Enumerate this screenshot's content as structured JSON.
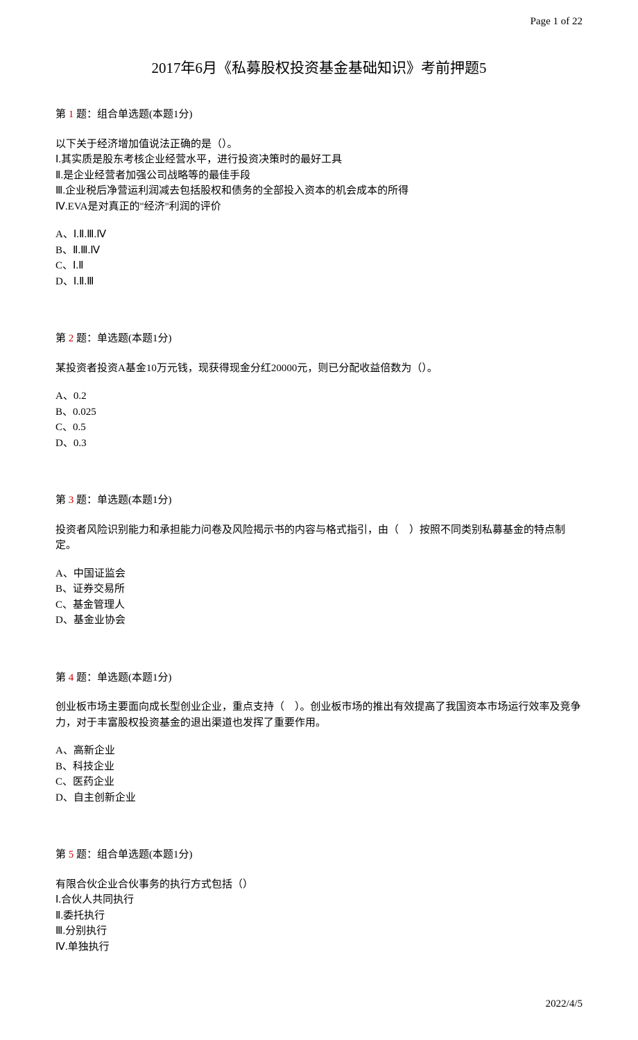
{
  "page_header": "Page 1 of 22",
  "title": "2017年6月《私募股权投资基金基础知识》考前押题5",
  "questions": [
    {
      "label_prefix": "第 ",
      "num": "1",
      "label_suffix": " 题：组合单选题(本题1分)",
      "lines": [
        "以下关于经济增加值说法正确的是（）。",
        "Ⅰ.其实质是股东考核企业经营水平，进行投资决策时的最好工具",
        "Ⅱ.是企业经营者加强公司战略等的最佳手段",
        "Ⅲ.企业税后净营运利润减去包括股权和债务的全部投入资本的机会成本的所得",
        "Ⅳ.EVA是对真正的\"经济\"利润的评价"
      ],
      "options": [
        "A、Ⅰ.Ⅱ.Ⅲ.Ⅳ",
        "B、Ⅱ.Ⅲ.Ⅳ",
        "C、Ⅰ.Ⅱ",
        "D、Ⅰ.Ⅱ.Ⅲ"
      ]
    },
    {
      "label_prefix": "第 ",
      "num": "2",
      "label_suffix": " 题：单选题(本题1分)",
      "lines": [
        "某投资者投资A基金10万元钱，现获得现金分红20000元，则已分配收益倍数为（）。"
      ],
      "options": [
        "A、0.2",
        "B、0.025",
        "C、0.5",
        "D、0.3"
      ]
    },
    {
      "label_prefix": "第 ",
      "num": "3",
      "label_suffix": " 题：单选题(本题1分)",
      "lines": [
        "投资者风险识别能力和承担能力问卷及风险揭示书的内容与格式指引，由（　）按照不同类别私募基金的特点制定。"
      ],
      "options": [
        "A、中国证监会",
        "B、证券交易所",
        "C、基金管理人",
        "D、基金业协会"
      ]
    },
    {
      "label_prefix": "第 ",
      "num": "4",
      "label_suffix": " 题：单选题(本题1分)",
      "lines": [
        "创业板市场主要面向成长型创业企业，重点支持（　）。创业板市场的推出有效提高了我国资本市场运行效率及竞争力，对于丰富股权投资基金的退出渠道也发挥了重要作用。"
      ],
      "options": [
        "A、高新企业",
        "B、科技企业",
        "C、医药企业",
        "D、自主创新企业"
      ]
    },
    {
      "label_prefix": "第 ",
      "num": "5",
      "label_suffix": " 题：组合单选题(本题1分)",
      "lines": [
        "有限合伙企业合伙事务的执行方式包括（）",
        "Ⅰ.合伙人共同执行",
        "Ⅱ.委托执行",
        "Ⅲ.分别执行",
        "Ⅳ.单独执行"
      ],
      "options": []
    }
  ],
  "footer": "2022/4/5"
}
